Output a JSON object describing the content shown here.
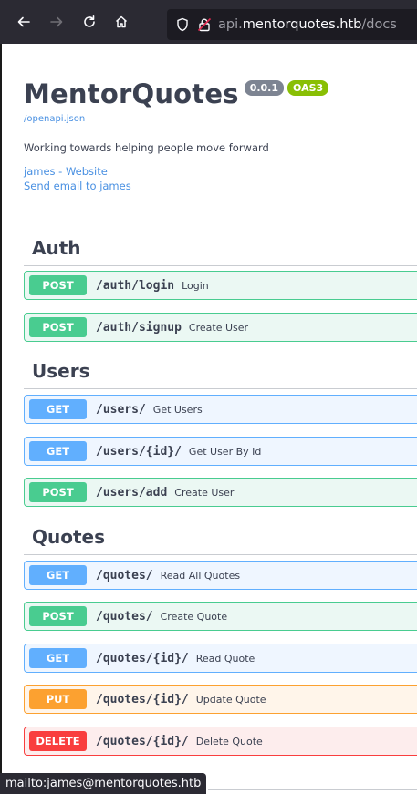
{
  "browser": {
    "url_prefix": "api.",
    "url_host": "mentorquotes.htb",
    "url_path": "/docs"
  },
  "info": {
    "title": "MentorQuotes",
    "version": "0.0.1",
    "oas": "OAS3",
    "openapi_link": "/openapi.json",
    "description": "Working towards helping people move forward",
    "contact_website": "james - Website",
    "contact_email": "Send email to james"
  },
  "sections": {
    "auth": "Auth",
    "users": "Users",
    "quotes": "Quotes"
  },
  "ops": [
    {
      "method": "POST",
      "path": "/auth/login",
      "summary": "Login"
    },
    {
      "method": "POST",
      "path": "/auth/signup",
      "summary": "Create User"
    },
    {
      "method": "GET",
      "path": "/users/",
      "summary": "Get Users"
    },
    {
      "method": "GET",
      "path": "/users/{id}/",
      "summary": "Get User By Id"
    },
    {
      "method": "POST",
      "path": "/users/add",
      "summary": "Create User"
    },
    {
      "method": "GET",
      "path": "/quotes/",
      "summary": "Read All Quotes"
    },
    {
      "method": "POST",
      "path": "/quotes/",
      "summary": "Create Quote"
    },
    {
      "method": "GET",
      "path": "/quotes/{id}/",
      "summary": "Read Quote"
    },
    {
      "method": "PUT",
      "path": "/quotes/{id}/",
      "summary": "Update Quote"
    },
    {
      "method": "DELETE",
      "path": "/quotes/{id}/",
      "summary": "Delete Quote"
    }
  ],
  "status": "mailto:james@mentorquotes.htb",
  "colors": {
    "post": "#49cc90",
    "get": "#61affe",
    "put": "#fca130",
    "delete": "#f93e3e",
    "link": "#4990e2"
  }
}
